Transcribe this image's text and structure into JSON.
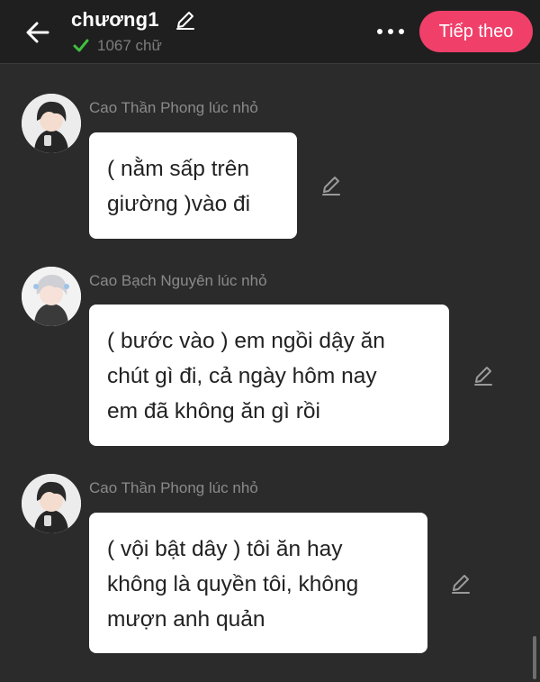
{
  "header": {
    "back_icon": "arrow-left-icon",
    "title": "chương1",
    "title_edit_icon": "pencil-icon",
    "word_count": "1067 chữ",
    "word_count_status_icon": "checkmark-icon",
    "more_icon": "ellipsis-icon",
    "next_label": "Tiếp theo",
    "accent_color": "#f0406a",
    "check_color": "#3fbf3f"
  },
  "messages": [
    {
      "speaker": "Cao Thần Phong lúc nhỏ",
      "lines": [
        "( nằm sấp trên",
        "giường )vào đi"
      ]
    },
    {
      "speaker": "Cao Bạch Nguyên lúc nhỏ",
      "lines": [
        "( bước vào ) em ngồi dậy ăn",
        "chút gì đi, cả ngày hôm nay",
        "em đã không ăn gì rồi"
      ]
    },
    {
      "speaker": "Cao Thần Phong lúc nhỏ",
      "lines": [
        "( vội bật dây ) tôi ăn hay",
        "không là quyền tôi, không",
        "mượn anh quản"
      ]
    }
  ]
}
